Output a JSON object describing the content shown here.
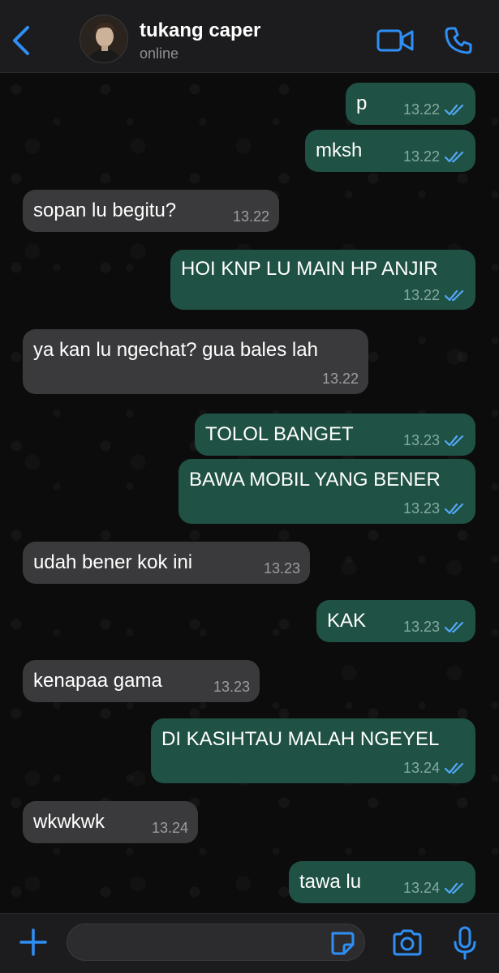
{
  "header": {
    "contact_name": "tukang caper",
    "status": "online"
  },
  "colors": {
    "accent": "#2f8ff5",
    "outgoing_bubble": "#1f5144",
    "incoming_bubble": "#3a3a3c",
    "read_ticks": "#53a7f5"
  },
  "messages": [
    {
      "dir": "out",
      "text": "p",
      "time": "13.22",
      "ticks": "read"
    },
    {
      "dir": "out",
      "text": "mksh",
      "time": "13.22",
      "ticks": "read"
    },
    {
      "dir": "in",
      "text": "sopan lu begitu?",
      "time": "13.22"
    },
    {
      "dir": "out",
      "text": "HOI KNP LU MAIN HP ANJIR",
      "time": "13.22",
      "ticks": "read"
    },
    {
      "dir": "in",
      "text": "ya kan lu ngechat? gua bales lah",
      "time": "13.22"
    },
    {
      "dir": "out",
      "text": "TOLOL BANGET",
      "time": "13.23",
      "ticks": "read"
    },
    {
      "dir": "out",
      "text": "BAWA MOBIL YANG BENER",
      "time": "13.23",
      "ticks": "read"
    },
    {
      "dir": "in",
      "text": "udah bener kok ini",
      "time": "13.23"
    },
    {
      "dir": "out",
      "text": "KAK",
      "time": "13.23",
      "ticks": "read"
    },
    {
      "dir": "in",
      "text": "kenapaa gama",
      "time": "13.23"
    },
    {
      "dir": "out",
      "text": "DI KASIHTAU MALAH NGEYEL",
      "time": "13.24",
      "ticks": "read"
    },
    {
      "dir": "in",
      "text": "wkwkwk",
      "time": "13.24"
    },
    {
      "dir": "out",
      "text": "tawa lu",
      "time": "13.24",
      "ticks": "read"
    }
  ],
  "input": {
    "value": "",
    "placeholder": ""
  },
  "icons": {
    "back": "chevron-left-icon",
    "video": "video-camera-icon",
    "call": "phone-icon",
    "plus": "plus-icon",
    "sticker": "sticker-icon",
    "camera": "camera-icon",
    "mic": "microphone-icon"
  }
}
